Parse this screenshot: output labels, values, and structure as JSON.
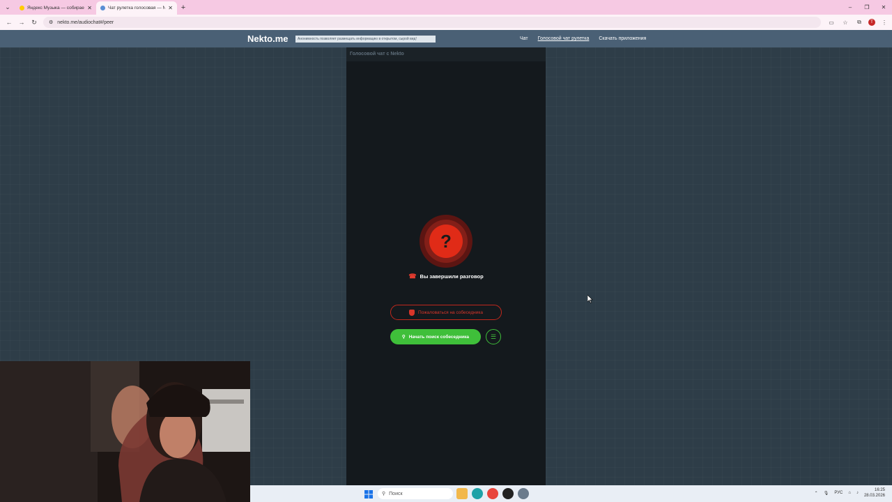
{
  "browser": {
    "tabs": [
      {
        "title": "Яндекс Музыка — собираем ...",
        "favicon_color": "#ffcc00",
        "active": false
      },
      {
        "title": "Чат рулетка голосовая — Nek...",
        "favicon_color": "#5a8fd4",
        "active": true
      }
    ],
    "url": "nekto.me/audiochat#/peer"
  },
  "site": {
    "logo": "Nekto.me",
    "notice": "Анонимность позволяет размещать информацию в открытом, сырой вид!",
    "nav": [
      "Чат",
      "Голосовой чат рулетка",
      "Скачать приложения"
    ]
  },
  "chat": {
    "header": "Голосовой чат с Nekto",
    "status_symbol": "?",
    "ended_text": "Вы завершили разговор",
    "report_label": "Пожаловаться на собеседника",
    "search_label": "Начать поиск собеседника"
  },
  "taskbar": {
    "search_placeholder": "Поиск",
    "lang": "РУС",
    "time": "16:25",
    "date": "28.03.2026"
  },
  "colors": {
    "accent_green": "#3fbf3a",
    "accent_red": "#e02b17",
    "header_bg": "#4a6075"
  }
}
